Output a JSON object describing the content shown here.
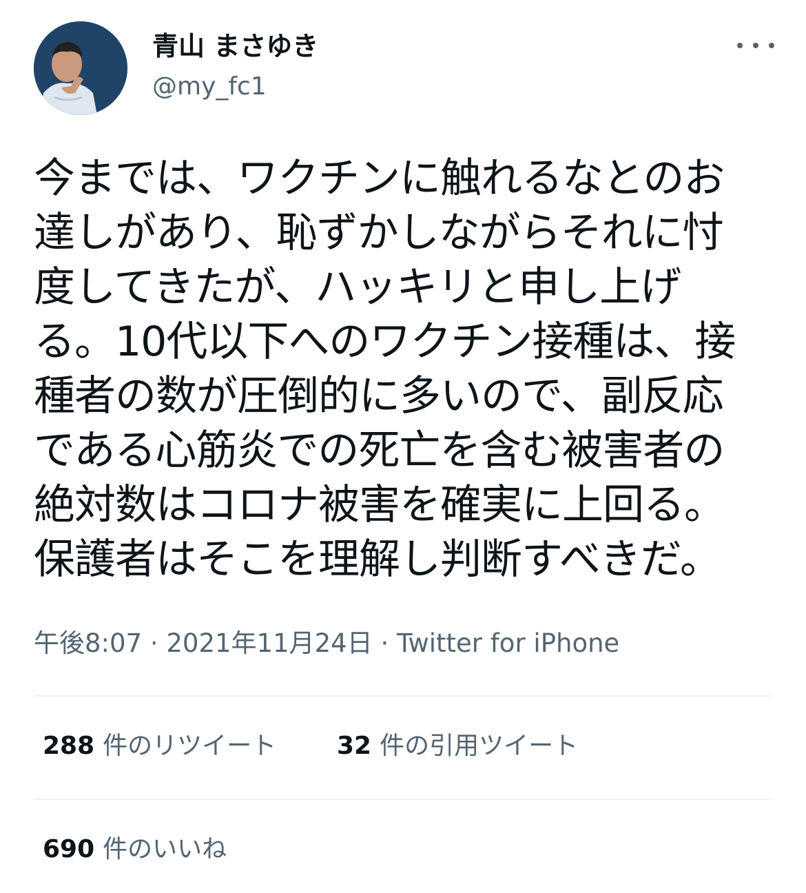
{
  "author": {
    "display_name": "青山 まさゆき",
    "handle": "@my_fc1",
    "avatar_icon": "profile-photo"
  },
  "more_icon": "more-horizontal-icon",
  "tweet": {
    "lines": [
      "今までは、ワクチンに触れるなとのお",
      "達しがあり、恥ずかしながらそれに忖",
      "度してきたが、ハッキリと申し上げ",
      "る。10代以下へのワクチン接種は、接",
      "種者の数が圧倒的に多いので、副反応",
      "である心筋炎での死亡を含む被害者の",
      "絶対数はコロナ被害を確実に上回る。",
      "保護者はそこを理解し判断すべきだ。"
    ]
  },
  "meta": {
    "time": "午後8:07",
    "date": "2021年11月24日",
    "separator": " · ",
    "source": "Twitter for iPhone"
  },
  "stats": {
    "retweets": {
      "count": "288",
      "label": "件のリツイート"
    },
    "quotes": {
      "count": "32",
      "label": "件の引用ツイート"
    },
    "likes": {
      "count": "690",
      "label": "件のいいね"
    }
  },
  "colors": {
    "text": "#0f1419",
    "secondary": "#536471",
    "divider": "#eff3f4"
  }
}
